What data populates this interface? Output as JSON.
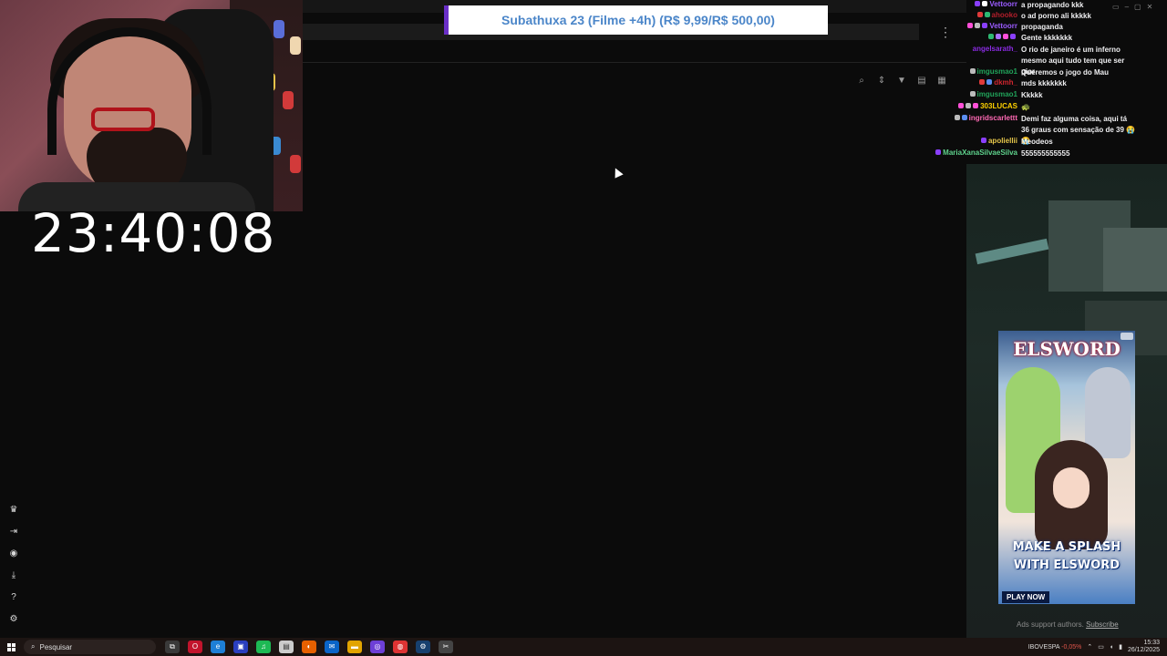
{
  "overlay": {
    "timer": "23:40:08",
    "banner": "Subathuxa 23 (Filme +4h) (R$ 9,99/R$ 500,00)"
  },
  "chat": {
    "messages": [
      {
        "user": "Vettoorr",
        "color": "#9b5cff",
        "text": "a propagando kkk",
        "badges": [
          "#8a3ffc",
          "#ffffff"
        ]
      },
      {
        "user": "ahooko",
        "color": "#b21e2b",
        "text": "o ad porno ali kkkkk",
        "badges": [
          "#e03a3a",
          "#2eb872"
        ]
      },
      {
        "user": "Vettoorr",
        "color": "#9b5cff",
        "text": "propaganda",
        "badges": [
          "#ff4fd8",
          "#bbbbbb",
          "#8a3ffc"
        ]
      },
      {
        "user": "",
        "color": "#9b5cff",
        "text": "Gente kkkkkkk",
        "badges": [
          "#2eb872",
          "#a970ff",
          "#ff4fd8",
          "#8a3ffc"
        ]
      },
      {
        "user": "angelsarath_",
        "color": "#8a2be2",
        "text": "O rio de janeiro é um inferno mesmo aqui tudo tem que ser pior",
        "badges": []
      },
      {
        "user": "imgusmao1",
        "color": "#21a35a",
        "text": "Queremos o jogo do Mau",
        "badges": [
          "#bbbbbb"
        ]
      },
      {
        "user": "dkmh_",
        "color": "#d0262f",
        "text": "mds kkkkkkk",
        "badges": [
          "#e03a3a",
          "#5b8def"
        ]
      },
      {
        "user": "imgusmao1",
        "color": "#21a35a",
        "text": "Kkkkk",
        "badges": [
          "#bbbbbb"
        ]
      },
      {
        "user": "303LUCAS",
        "color": "#ffd200",
        "text": "🐢",
        "badges": [
          "#ff4fd8",
          "#bbbbbb",
          "#ff4fd8"
        ]
      },
      {
        "user": "ingridscarlettt",
        "color": "#ff69b4",
        "text": "Demi faz alguma coisa, aqui tá 36 graus com sensação de 39 😭😭",
        "badges": [
          "#bbbbbb",
          "#5b8def"
        ]
      },
      {
        "user": "apoliellii",
        "color": "#e6c64a",
        "text": "Meodeos",
        "badges": [
          "#8a3ffc"
        ]
      },
      {
        "user": "MariaXanaSilvaeSilva",
        "color": "#5fd38d",
        "text": "555555555555",
        "badges": [
          "#8a3ffc"
        ]
      }
    ]
  },
  "ad": {
    "logo": "ELSWORD",
    "slogan_line1": "MAKE A SPLASH",
    "slogan_line2": "WITH ELSWORD",
    "cta": "PLAY NOW",
    "note_prefix": "Ads support authors.",
    "note_link": "Subscribe"
  },
  "taskbar": {
    "search_placeholder": "Pesquisar",
    "stock_name": "IBOVESPA",
    "stock_change": "-0,05%",
    "time": "15:33",
    "date": "26/12/2025"
  }
}
